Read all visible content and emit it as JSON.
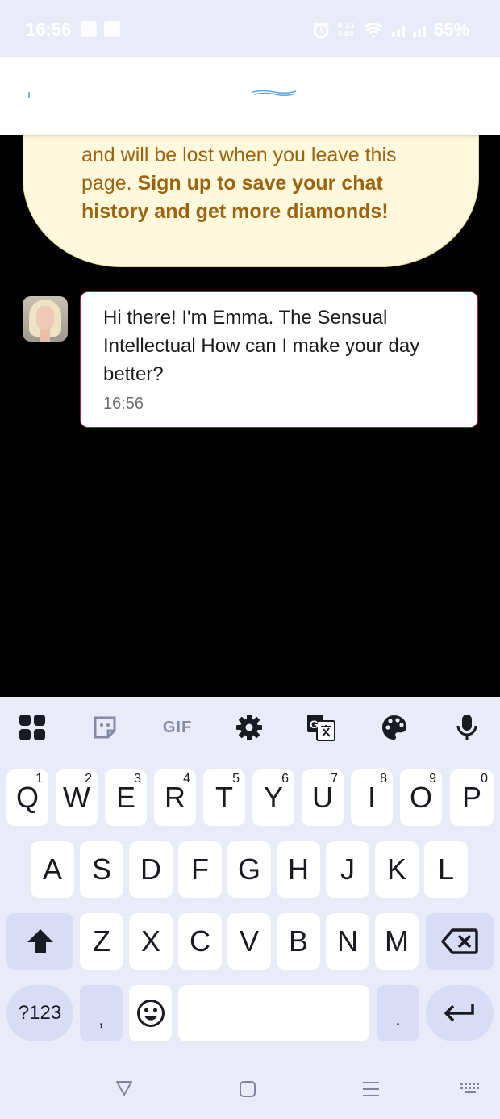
{
  "status_bar": {
    "time": "16:56",
    "net_speed_value": "0.21",
    "net_speed_unit": "KB/S",
    "battery": "65%"
  },
  "chat": {
    "notice_plain": "and will be lost when you leave this page. ",
    "notice_bold": "Sign up to save your chat history and get more diamonds!",
    "message": {
      "text": "Hi there! I'm Emma. The Sensual Intellectual How can I make your day better?",
      "time": "16:56"
    }
  },
  "keyboard": {
    "toolbar": [
      "apps-icon",
      "sticker-icon",
      "gif-icon",
      "settings-icon",
      "translate-icon",
      "palette-icon",
      "mic-icon"
    ],
    "gif_label": "GIF",
    "row1": [
      {
        "k": "Q",
        "n": "1"
      },
      {
        "k": "W",
        "n": "2"
      },
      {
        "k": "E",
        "n": "3"
      },
      {
        "k": "R",
        "n": "4"
      },
      {
        "k": "T",
        "n": "5"
      },
      {
        "k": "Y",
        "n": "6"
      },
      {
        "k": "U",
        "n": "7"
      },
      {
        "k": "I",
        "n": "8"
      },
      {
        "k": "O",
        "n": "9"
      },
      {
        "k": "P",
        "n": "0"
      }
    ],
    "row2": [
      "A",
      "S",
      "D",
      "F",
      "G",
      "H",
      "J",
      "K",
      "L"
    ],
    "row3": [
      "Z",
      "X",
      "C",
      "V",
      "B",
      "N",
      "M"
    ],
    "symbols_label": "?123",
    "comma_label": ",",
    "period_label": "."
  },
  "colors": {
    "notice_bg": "#fef8dc",
    "notice_text": "#9c6410",
    "bubble_border": "#a0244e",
    "keyboard_bg": "#e9ebf8"
  }
}
